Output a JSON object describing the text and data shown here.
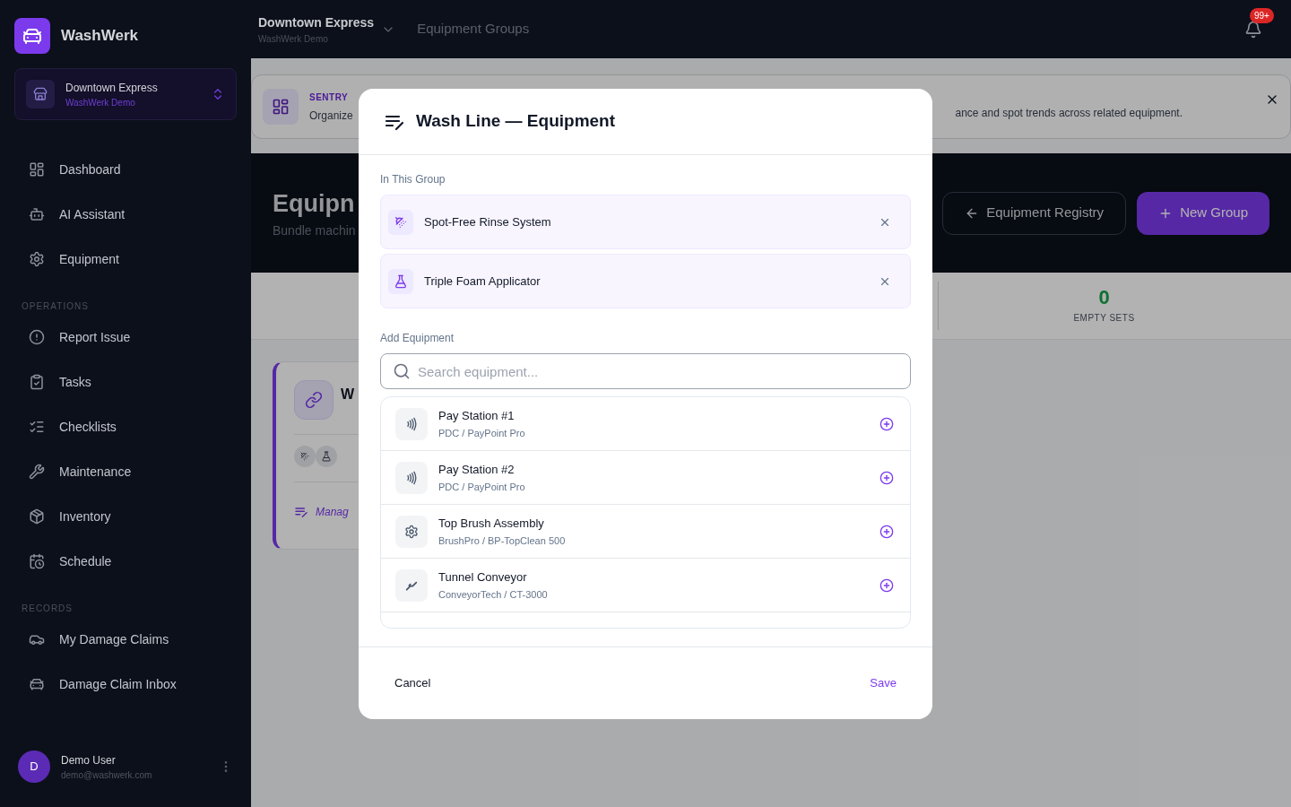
{
  "app": {
    "name": "WashWerk"
  },
  "location_switcher": {
    "name": "Downtown Express",
    "org": "WashWerk Demo"
  },
  "nav": [
    {
      "label": "Dashboard",
      "selected": false
    },
    {
      "label": "AI Assistant",
      "selected": false
    },
    {
      "label": "Equipment",
      "selected": false
    }
  ],
  "sections": [
    {
      "title": "OPERATIONS",
      "items": [
        {
          "label": "Report Issue",
          "selected": false
        },
        {
          "label": "Tasks",
          "selected": false
        },
        {
          "label": "Checklists",
          "selected": false
        },
        {
          "label": "Maintenance",
          "selected": false
        },
        {
          "label": "Inventory",
          "selected": false
        },
        {
          "label": "Schedule",
          "selected": false
        }
      ]
    },
    {
      "title": "RECORDS",
      "items": [
        {
          "label": "My Damage Claims",
          "selected": false
        },
        {
          "label": "Damage Claim Inbox",
          "selected": false
        }
      ]
    }
  ],
  "user": {
    "initial": "D",
    "name": "Demo User",
    "email": "demo@washwerk.com"
  },
  "topbar": {
    "location": "Downtown Express",
    "org": "WashWerk Demo",
    "breadcrumb": "Equipment Groups",
    "notifications": "99+"
  },
  "banner": {
    "tag": "SENTRY",
    "text_left": "Organize",
    "text_right": "ance and spot trends across related equipment."
  },
  "hero": {
    "title": "Equipn",
    "subtitle": "Bundle machin",
    "buttons": [
      {
        "label": "Equipment Registry",
        "kind": "outline"
      },
      {
        "label": "New Group",
        "kind": "primary"
      }
    ]
  },
  "stats": [
    {
      "value": "0",
      "label": "EMPTY SETS"
    }
  ],
  "group_card": {
    "title": "W",
    "action": "Manag"
  },
  "modal": {
    "title": "Wash Line — Equipment",
    "members_label": "In This Group",
    "members": [
      {
        "name": "Spot-Free Rinse System",
        "kind": "faucet"
      },
      {
        "name": "Triple Foam Applicator",
        "kind": "flask"
      }
    ],
    "add_label": "Add Equipment",
    "search_placeholder": "Search equipment...",
    "available": [
      {
        "name": "Pay Station #1",
        "detail": "PDC / PayPoint Pro",
        "kind": "contactless"
      },
      {
        "name": "Pay Station #2",
        "detail": "PDC / PayPoint Pro",
        "kind": "contactless"
      },
      {
        "name": "Top Brush Assembly",
        "detail": "BrushPro / BP-TopClean 500",
        "kind": "gear"
      },
      {
        "name": "Tunnel Conveyor",
        "detail": "ConveyorTech / CT-3000",
        "kind": "conveyor"
      }
    ],
    "cancel": "Cancel",
    "save": "Save"
  }
}
